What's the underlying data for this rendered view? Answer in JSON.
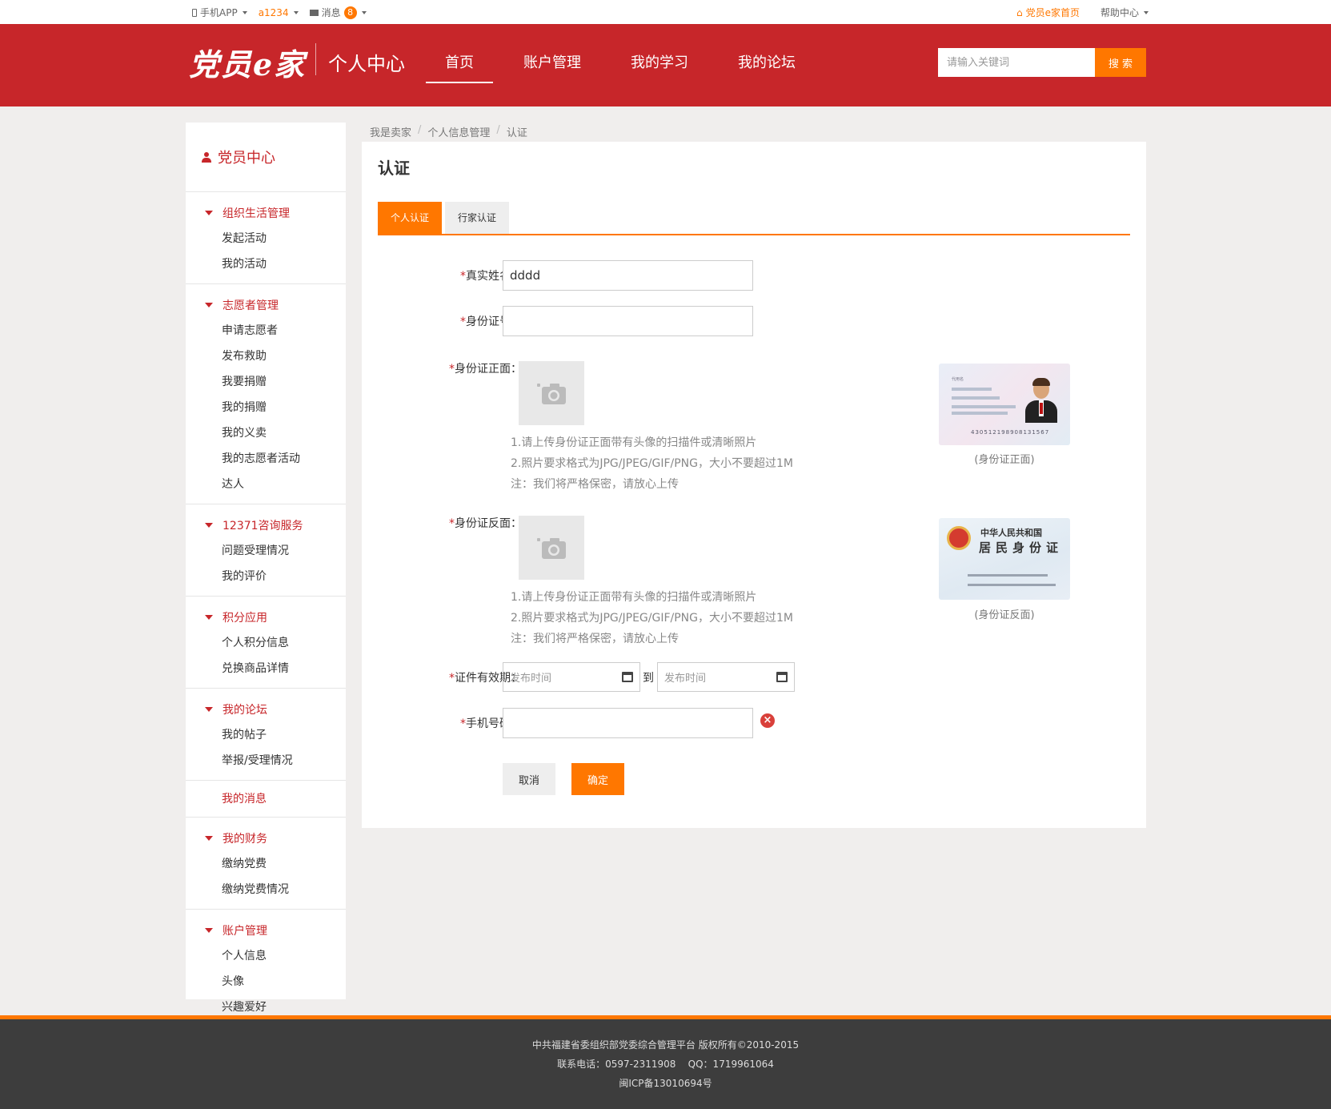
{
  "topbar": {
    "mobile_app": "手机APP",
    "username": "a1234",
    "messages_label": "消息",
    "messages_count": "8",
    "home_link": "党员e家首页",
    "help_center": "帮助中心"
  },
  "header": {
    "logo": "党员e家",
    "subtitle": "个人中心",
    "nav": [
      "首页",
      "账户管理",
      "我的学习",
      "我的论坛"
    ],
    "search_placeholder": "请输入关键词",
    "search_button": "搜 索"
  },
  "sidebar": {
    "title": "党员中心",
    "groups": [
      {
        "title": "组织生活管理",
        "items": [
          "发起活动",
          "我的活动"
        ]
      },
      {
        "title": "志愿者管理",
        "items": [
          "申请志愿者",
          "发布救助",
          "我要捐赠",
          "我的捐赠",
          "我的义卖",
          "我的志愿者活动",
          "达人"
        ]
      },
      {
        "title": "12371咨询服务",
        "items": [
          "问题受理情况",
          "我的评价"
        ]
      },
      {
        "title": "积分应用",
        "items": [
          "个人积分信息",
          "兑换商品详情"
        ]
      },
      {
        "title": "我的论坛",
        "items": [
          "我的帖子",
          "举报/受理情况"
        ]
      }
    ],
    "single": "我的消息",
    "groups2": [
      {
        "title": "我的财务",
        "items": [
          "缴纳党费",
          "缴纳党费情况"
        ]
      },
      {
        "title": "账户管理",
        "items": [
          "个人信息",
          "头像",
          "兴趣爱好"
        ]
      }
    ]
  },
  "breadcrumb": [
    "我是卖家",
    "个人信息管理",
    "认证"
  ],
  "main": {
    "title": "认证",
    "tabs": [
      "个人认证",
      "行家认证"
    ],
    "form": {
      "name_label": "真实姓名：",
      "name_value": "dddd",
      "id_label": "身份证号：",
      "id_value": "",
      "front_label": "身份证正面：",
      "back_label": "身份证反面：",
      "hints": [
        "1.请上传身份证正面带有头像的扫描件或清晰照片",
        "2.照片要求格式为JPG/JPEG/GIF/PNG，大小不要超过1M",
        "注：我们将严格保密，请放心上传"
      ],
      "front_caption": "(身份证正面)",
      "back_caption": "(身份证反面)",
      "validity_label": "证件有效期：",
      "date_placeholder": "发布时间",
      "to": "到",
      "phone_label": "手机号码：",
      "phone_value": "",
      "cancel": "取消",
      "confirm": "确定",
      "required_mark": "*"
    },
    "card_front": {
      "name_field": "代用名",
      "number": "430512198908131567"
    },
    "card_back": {
      "line1": "中华人民共和国",
      "line2": "居民身份证"
    }
  },
  "footer": {
    "line1": "中共福建省委组织部党委综合管理平台 版权所有©2010-2015",
    "line2": "联系电话：0597-2311908    QQ：1719961064",
    "line3": "闽ICP备13010694号"
  },
  "colors": {
    "brand_red": "#c7262a",
    "accent_orange": "#ff7700"
  }
}
